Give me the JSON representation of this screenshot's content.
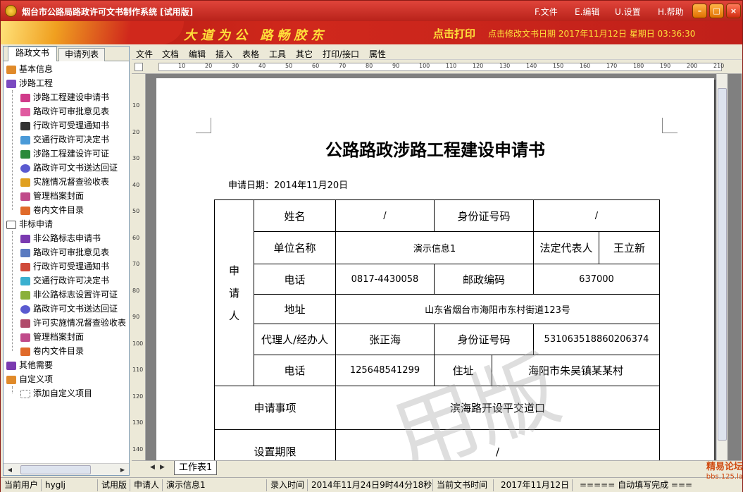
{
  "window": {
    "title": "烟台市公路局路政许可文书制作系统 [试用版]",
    "menu": [
      "F.文件",
      "E.编辑",
      "U.设置",
      "H.帮助"
    ]
  },
  "banner": {
    "slogan": "大道为公  路畅胶东",
    "print_label": "点击打印",
    "datetime": "点击修改文书日期  2017年11月12日  星期日  03:36:30"
  },
  "left_tabs": [
    "路政文书",
    "申请列表"
  ],
  "tree": {
    "basic": "基本信息",
    "group1": {
      "label": "涉路工程",
      "items": [
        "涉路工程建设申请书",
        "路政许可审批意见表",
        "行政许可受理通知书",
        "交通行政许可决定书",
        "涉路工程建设许可证",
        "路政许可文书送达回证",
        "实施情况督查验收表",
        "管理档案封面",
        "卷内文件目录"
      ]
    },
    "group2": {
      "label": "非标申请",
      "items": [
        "非公路标志申请书",
        "路政许可审批意见表",
        "行政许可受理通知书",
        "交通行政许可决定书",
        "非公路标志设置许可证",
        "路政许可文书送达回证",
        "许可实施情况督查验收表",
        "管理档案封面",
        "卷内文件目录"
      ]
    },
    "other": "其他需要",
    "custom": {
      "label": "自定义项",
      "items": [
        "添加自定义项目"
      ]
    }
  },
  "editor_menu": [
    "文件",
    "文档",
    "编辑",
    "插入",
    "表格",
    "工具",
    "其它",
    "打印/接口",
    "属性"
  ],
  "hruler_ticks": [
    "10",
    "20",
    "30",
    "40",
    "50",
    "60",
    "70",
    "80",
    "90",
    "100",
    "110",
    "120",
    "130",
    "140",
    "150",
    "160",
    "170",
    "180",
    "190",
    "200",
    "210"
  ],
  "vruler_ticks": [
    "10",
    "20",
    "30",
    "40",
    "50",
    "60",
    "70",
    "80",
    "90",
    "100",
    "110",
    "120",
    "130",
    "140"
  ],
  "document": {
    "title": "公路路政涉路工程建设申请书",
    "date_line": "申请日期：2014年11月20日",
    "applicant_label": "申\n\n请\n\n人",
    "rows": {
      "name_label": "姓名",
      "name_value": "/",
      "id_label": "身份证号码",
      "id_value": "/",
      "unit_label": "单位名称",
      "unit_value": "演示信息1",
      "legal_label": "法定代表人",
      "legal_value": "王立新",
      "phone_label": "电话",
      "phone_value": "0817-4430058",
      "postcode_label": "邮政编码",
      "postcode_value": "637000",
      "addr_label": "地址",
      "addr_value": "山东省烟台市海阳市东村街道123号",
      "agent_label": "代理人/经办人",
      "agent_value": "张正海",
      "agent_id_label": "身份证号码",
      "agent_id_value": "531063518860206374",
      "agent_phone_label": "电话",
      "agent_phone_value": "125648541299",
      "residence_label": "住址",
      "residence_value": "海阳市朱吴镇某某村",
      "matter_label": "申请事项",
      "matter_value": "滨海路开设平交道口",
      "period_label": "设置期限",
      "period_value": "/"
    },
    "watermark": "用版"
  },
  "sheet_tab": "工作表1",
  "status": {
    "user_label": "当前用户",
    "user": "hyglj",
    "edition": "试用版",
    "applicant_label": "申请人",
    "applicant": "演示信息1",
    "entry_label": "录入时间",
    "entry_time": "2014年11月24日9时44分18秒",
    "docdate_label": "当前文书时间",
    "docdate": "2017年11月12日",
    "autofill": "===== 自动填写完成 ====="
  },
  "forum": {
    "name": "精易论坛",
    "url": "bbs.125.la"
  }
}
